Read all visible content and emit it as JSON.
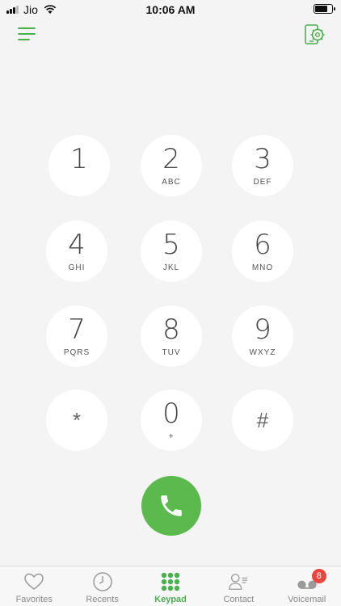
{
  "status_bar": {
    "carrier": "Jio",
    "time": "10:06 AM",
    "battery_level": 0.8
  },
  "header": {
    "menu_icon": "hamburger-icon",
    "settings_icon": "device-settings-icon"
  },
  "keypad": {
    "keys": [
      {
        "digit": "1",
        "letters": ""
      },
      {
        "digit": "2",
        "letters": "ABC"
      },
      {
        "digit": "3",
        "letters": "DEF"
      },
      {
        "digit": "4",
        "letters": "GHI"
      },
      {
        "digit": "5",
        "letters": "JKL"
      },
      {
        "digit": "6",
        "letters": "MNO"
      },
      {
        "digit": "7",
        "letters": "PQRS"
      },
      {
        "digit": "8",
        "letters": "TUV"
      },
      {
        "digit": "9",
        "letters": "WXYZ"
      },
      {
        "digit": "*",
        "letters": ""
      },
      {
        "digit": "0",
        "letters": "+"
      },
      {
        "digit": "#",
        "letters": ""
      }
    ],
    "call_icon": "phone-icon"
  },
  "tabs": [
    {
      "label": "Favorites",
      "icon": "heart-icon"
    },
    {
      "label": "Recents",
      "icon": "clock-icon"
    },
    {
      "label": "Keypad",
      "icon": "keypad-icon"
    },
    {
      "label": "Contact",
      "icon": "contact-icon"
    },
    {
      "label": "Voicemail",
      "icon": "voicemail-icon",
      "badge": "8"
    }
  ],
  "colors": {
    "accent": "#4caf50",
    "call_button": "#5cb94e",
    "badge": "#e8463c"
  }
}
